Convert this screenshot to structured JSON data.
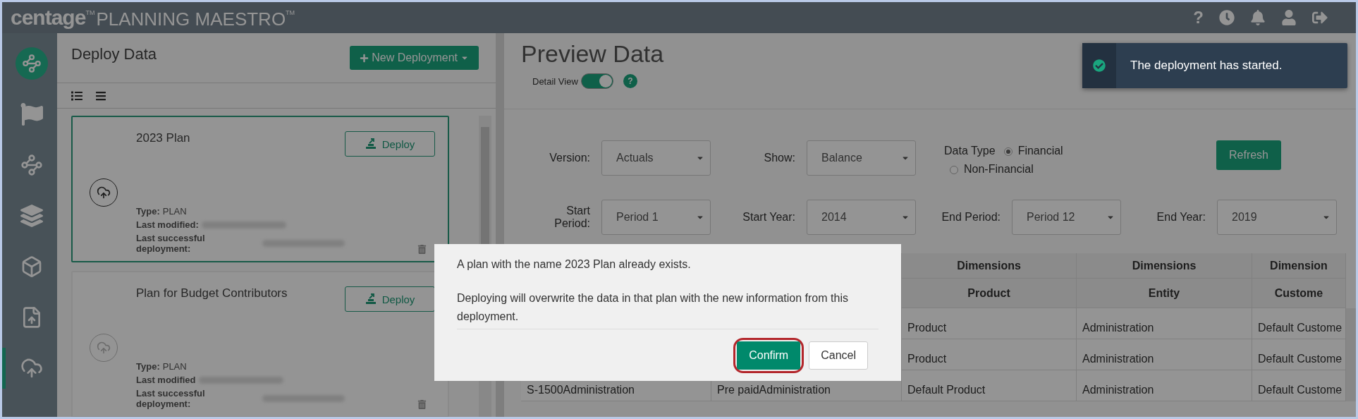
{
  "header": {
    "logo": {
      "brand": "centage",
      "brand_tm": "TM",
      "product": "PLANNING MAESTRO",
      "product_tm": "TM"
    },
    "help_icon": "?"
  },
  "sidebar": {
    "items": [
      {
        "selected": false
      },
      {
        "selected": false
      },
      {
        "selected": false
      },
      {
        "selected": false
      },
      {
        "selected": false
      },
      {
        "selected": false
      },
      {
        "selected": true
      }
    ]
  },
  "deploy_panel": {
    "title": "Deploy Data",
    "new_button": "New Deployment",
    "cards": [
      {
        "title": "2023 Plan",
        "button": "Deploy",
        "selected": true,
        "type_label": "Type:",
        "type": "PLAN",
        "modified_label": "Last modified:",
        "deployment_label": "Last successful deployment:"
      },
      {
        "title": "Plan for Budget Contributors",
        "button": "Deploy",
        "selected": false,
        "type_label": "Type:",
        "type": "PLAN",
        "modified_label": "Last modified",
        "deployment_label": "Last successful deployment:"
      }
    ]
  },
  "preview": {
    "title": "Preview Data",
    "detail_view": {
      "label": "Detail View",
      "on": true
    },
    "filters": [
      {
        "label": "Version:",
        "value": "Actuals"
      },
      {
        "label": "Show:",
        "value": "Balance"
      },
      {
        "label": "Start Period:",
        "value": "Period 1"
      },
      {
        "label": "Start Year:",
        "value": "2014"
      },
      {
        "label": "End Period:",
        "value": "Period 12"
      },
      {
        "label": "End Year:",
        "value": "2019"
      }
    ],
    "data_type": {
      "label": "Data Type",
      "options": [
        {
          "label": "Financial",
          "selected": true
        },
        {
          "label": "Non-Financial",
          "selected": false
        }
      ]
    },
    "refresh": "Refresh",
    "table": {
      "group_headers": [
        "Dimensions",
        "Dimensions",
        "Dimension"
      ],
      "headers": [
        "Product",
        "Entity",
        "Custome"
      ],
      "rows": [
        {
          "cells": [
            "",
            "",
            "Product",
            "Administration",
            "Default Custome"
          ]
        },
        {
          "cells": [
            "",
            "",
            "Product",
            "Administration",
            "Default Custome"
          ]
        },
        {
          "cells": [
            "S-1500Administration",
            "Pre paidAdministration",
            "Default Product",
            "Administration",
            "Default Custome"
          ]
        }
      ]
    }
  },
  "toast": {
    "message": "The deployment has started."
  },
  "dialog": {
    "message": "A plan with the name 2023 Plan already exists.",
    "detail": "Deploying will overwrite the data in that plan with the new information from this deployment.",
    "buttons": [
      {
        "label": "Confirm",
        "kind": "primary",
        "highlighted": true
      },
      {
        "label": "Cancel",
        "kind": "secondary",
        "highlighted": false
      }
    ]
  }
}
